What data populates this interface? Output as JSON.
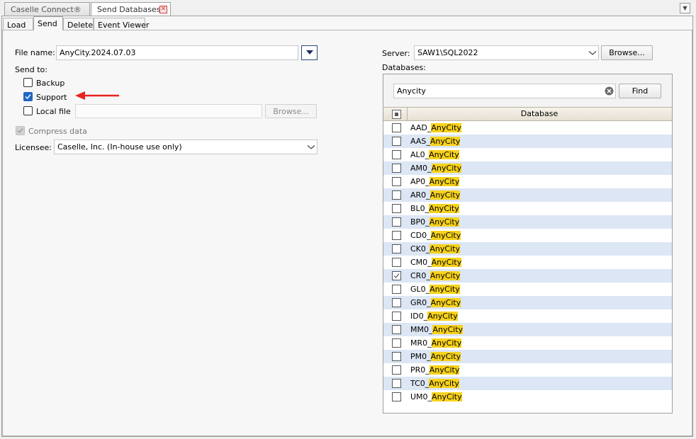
{
  "doc_tabs": [
    {
      "label": "Caselle Connect®"
    },
    {
      "label": "Send Databases"
    }
  ],
  "sub_tabs": [
    {
      "label": "Load"
    },
    {
      "label": "Send"
    },
    {
      "label": "Delete"
    },
    {
      "label": "Event Viewer"
    }
  ],
  "left": {
    "file_name_label": "File name:",
    "file_name_value": "AnyCity.2024.07.03",
    "send_to_label": "Send to:",
    "backup_label": "Backup",
    "backup_checked": false,
    "support_label": "Support",
    "support_checked": true,
    "local_file_label": "Local file",
    "local_file_checked": false,
    "local_file_value": "",
    "browse_label": "Browse...",
    "compress_label": "Compress data",
    "compress_checked": true,
    "licensee_label": "Licensee:",
    "licensee_value": "Caselle, Inc. (In-house use only)"
  },
  "right": {
    "server_label": "Server:",
    "server_value": "SAW1\\SQL2022",
    "browse_label": "Browse...",
    "databases_label": "Databases:",
    "search_value": "Anycity",
    "find_label": "Find",
    "column_header": "Database",
    "match_text": "AnyCity",
    "rows": [
      {
        "prefix": "AAD_",
        "match": "AnyCity",
        "checked": false
      },
      {
        "prefix": "AAS_",
        "match": "AnyCity",
        "checked": false
      },
      {
        "prefix": "AL0_",
        "match": "AnyCity",
        "checked": false
      },
      {
        "prefix": "AM0_",
        "match": "AnyCity",
        "checked": false
      },
      {
        "prefix": "AP0_",
        "match": "AnyCity",
        "checked": false
      },
      {
        "prefix": "AR0_",
        "match": "AnyCity",
        "checked": false
      },
      {
        "prefix": "BL0_",
        "match": "AnyCity",
        "checked": false
      },
      {
        "prefix": "BP0_",
        "match": "AnyCity",
        "checked": false
      },
      {
        "prefix": "CD0_",
        "match": "AnyCity",
        "checked": false
      },
      {
        "prefix": "CK0_",
        "match": "AnyCity",
        "checked": false
      },
      {
        "prefix": "CM0_",
        "match": "AnyCity",
        "checked": false
      },
      {
        "prefix": "CR0_",
        "match": "AnyCity",
        "checked": true
      },
      {
        "prefix": "GL0_",
        "match": "AnyCity",
        "checked": false
      },
      {
        "prefix": "GR0_",
        "match": "AnyCity",
        "checked": false
      },
      {
        "prefix": "ID0_",
        "match": "AnyCity",
        "checked": false
      },
      {
        "prefix": "MM0_",
        "match": "AnyCity",
        "checked": false
      },
      {
        "prefix": "MR0_",
        "match": "AnyCity",
        "checked": false
      },
      {
        "prefix": "PM0_",
        "match": "AnyCity",
        "checked": false
      },
      {
        "prefix": "PR0_",
        "match": "AnyCity",
        "checked": false
      },
      {
        "prefix": "TC0_",
        "match": "AnyCity",
        "checked": false
      },
      {
        "prefix": "UM0_",
        "match": "AnyCity",
        "checked": false
      }
    ]
  },
  "colors": {
    "highlight": "#f7d21b",
    "alt_row": "#dce6f5",
    "checkbox_checked": "#2167c3",
    "arrow": "#e8231d"
  }
}
